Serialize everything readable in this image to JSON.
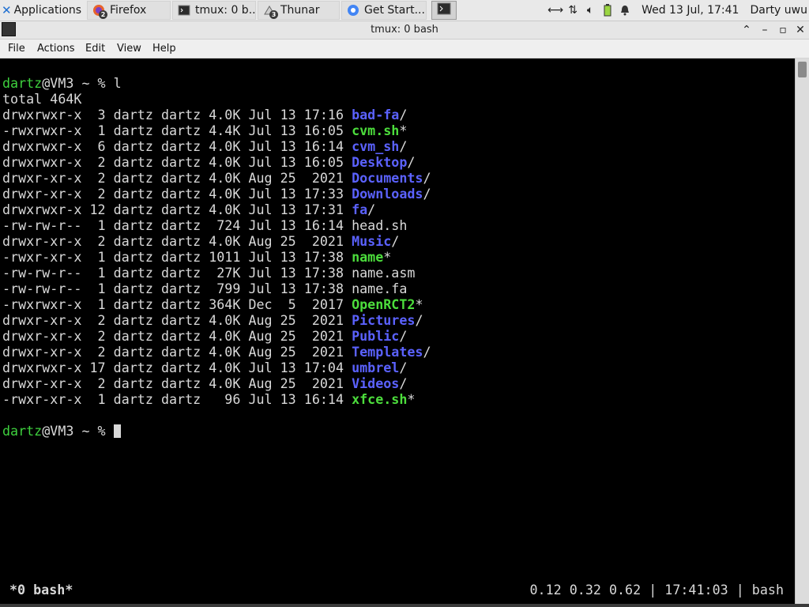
{
  "panel": {
    "applications_label": "Applications ☰",
    "tasks": [
      {
        "label": "Firefox",
        "badge": "2",
        "icon": "firefox-icon"
      },
      {
        "label": "tmux: 0 b...",
        "badge": "",
        "icon": "terminal-icon"
      },
      {
        "label": "Thunar",
        "badge": "3",
        "icon": "folder-icon"
      },
      {
        "label": "Get Start...",
        "badge": "",
        "icon": "chrome-icon"
      }
    ],
    "clock": "Wed 13 Jul, 17:41",
    "user": "Darty uwu"
  },
  "window": {
    "title": "tmux: 0 bash"
  },
  "menu": {
    "items": [
      "File",
      "Actions",
      "Edit",
      "View",
      "Help"
    ]
  },
  "terminal": {
    "prompt_user": "dartz",
    "prompt_rest": "@VM3 ~ % ",
    "command": "l",
    "total": "total 464K",
    "entries": [
      {
        "perm": "drwxrwxr-x",
        "links": " 3",
        "user": "dartz",
        "group": "dartz",
        "size": "4.0K",
        "date": "Jul 13 17:16",
        "name": "bad-fa",
        "type": "dir",
        "suffix": "/"
      },
      {
        "perm": "-rwxrwxr-x",
        "links": " 1",
        "user": "dartz",
        "group": "dartz",
        "size": "4.4K",
        "date": "Jul 13 16:05",
        "name": "cvm.sh",
        "type": "exe",
        "suffix": "*"
      },
      {
        "perm": "drwxrwxr-x",
        "links": " 6",
        "user": "dartz",
        "group": "dartz",
        "size": "4.0K",
        "date": "Jul 13 16:14",
        "name": "cvm_sh",
        "type": "dir",
        "suffix": "/"
      },
      {
        "perm": "drwxrwxr-x",
        "links": " 2",
        "user": "dartz",
        "group": "dartz",
        "size": "4.0K",
        "date": "Jul 13 16:05",
        "name": "Desktop",
        "type": "dir",
        "suffix": "/"
      },
      {
        "perm": "drwxr-xr-x",
        "links": " 2",
        "user": "dartz",
        "group": "dartz",
        "size": "4.0K",
        "date": "Aug 25  2021",
        "name": "Documents",
        "type": "dir",
        "suffix": "/"
      },
      {
        "perm": "drwxr-xr-x",
        "links": " 2",
        "user": "dartz",
        "group": "dartz",
        "size": "4.0K",
        "date": "Jul 13 17:33",
        "name": "Downloads",
        "type": "dir",
        "suffix": "/"
      },
      {
        "perm": "drwxrwxr-x",
        "links": "12",
        "user": "dartz",
        "group": "dartz",
        "size": "4.0K",
        "date": "Jul 13 17:31",
        "name": "fa",
        "type": "dir",
        "suffix": "/"
      },
      {
        "perm": "-rw-rw-r--",
        "links": " 1",
        "user": "dartz",
        "group": "dartz",
        "size": " 724",
        "date": "Jul 13 16:14",
        "name": "head.sh",
        "type": "file",
        "suffix": ""
      },
      {
        "perm": "drwxr-xr-x",
        "links": " 2",
        "user": "dartz",
        "group": "dartz",
        "size": "4.0K",
        "date": "Aug 25  2021",
        "name": "Music",
        "type": "dir",
        "suffix": "/"
      },
      {
        "perm": "-rwxr-xr-x",
        "links": " 1",
        "user": "dartz",
        "group": "dartz",
        "size": "1011",
        "date": "Jul 13 17:38",
        "name": "name",
        "type": "exe",
        "suffix": "*"
      },
      {
        "perm": "-rw-rw-r--",
        "links": " 1",
        "user": "dartz",
        "group": "dartz",
        "size": " 27K",
        "date": "Jul 13 17:38",
        "name": "name.asm",
        "type": "file",
        "suffix": ""
      },
      {
        "perm": "-rw-rw-r--",
        "links": " 1",
        "user": "dartz",
        "group": "dartz",
        "size": " 799",
        "date": "Jul 13 17:38",
        "name": "name.fa",
        "type": "file",
        "suffix": ""
      },
      {
        "perm": "-rwxrwxr-x",
        "links": " 1",
        "user": "dartz",
        "group": "dartz",
        "size": "364K",
        "date": "Dec  5  2017",
        "name": "OpenRCT2",
        "type": "exe",
        "suffix": "*"
      },
      {
        "perm": "drwxr-xr-x",
        "links": " 2",
        "user": "dartz",
        "group": "dartz",
        "size": "4.0K",
        "date": "Aug 25  2021",
        "name": "Pictures",
        "type": "dir",
        "suffix": "/"
      },
      {
        "perm": "drwxr-xr-x",
        "links": " 2",
        "user": "dartz",
        "group": "dartz",
        "size": "4.0K",
        "date": "Aug 25  2021",
        "name": "Public",
        "type": "dir",
        "suffix": "/"
      },
      {
        "perm": "drwxr-xr-x",
        "links": " 2",
        "user": "dartz",
        "group": "dartz",
        "size": "4.0K",
        "date": "Aug 25  2021",
        "name": "Templates",
        "type": "dir",
        "suffix": "/"
      },
      {
        "perm": "drwxrwxr-x",
        "links": "17",
        "user": "dartz",
        "group": "dartz",
        "size": "4.0K",
        "date": "Jul 13 17:04",
        "name": "umbrel",
        "type": "dir",
        "suffix": "/"
      },
      {
        "perm": "drwxr-xr-x",
        "links": " 2",
        "user": "dartz",
        "group": "dartz",
        "size": "4.0K",
        "date": "Aug 25  2021",
        "name": "Videos",
        "type": "dir",
        "suffix": "/"
      },
      {
        "perm": "-rwxr-xr-x",
        "links": " 1",
        "user": "dartz",
        "group": "dartz",
        "size": "  96",
        "date": "Jul 13 16:14",
        "name": "xfce.sh",
        "type": "exe",
        "suffix": "*"
      }
    ]
  },
  "status": {
    "left": "*0 bash*",
    "right": "0.12 0.32 0.62 | 17:41:03 | bash"
  },
  "colors": {
    "dir": "#5b62ff",
    "exe": "#4cdd3c",
    "prompt_user": "#3ed13e",
    "text": "#d9d9d9"
  }
}
